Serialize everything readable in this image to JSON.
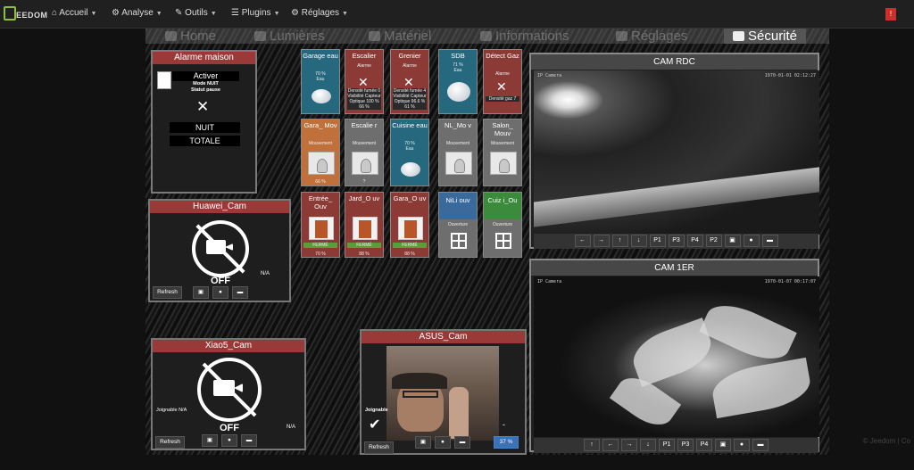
{
  "brand": {
    "name": "EEDOM"
  },
  "nav": {
    "items": [
      {
        "label": "Accueil",
        "icon": "home-icon"
      },
      {
        "label": "Analyse",
        "icon": "analyse-icon"
      },
      {
        "label": "Outils",
        "icon": "wrench-icon"
      },
      {
        "label": "Plugins",
        "icon": "plugins-icon"
      },
      {
        "label": "Réglages",
        "icon": "gears-icon"
      }
    ],
    "alert_count": "!"
  },
  "tabs": [
    "Home",
    "Lumières",
    "Matériel",
    "Informations",
    "Réglages",
    "Sécurité"
  ],
  "alarm": {
    "title": "Alarme maison",
    "activate": "Activer",
    "mode": "Mode NUIT",
    "status": "Statut pause",
    "night": "NUIT",
    "total": "TOTALE"
  },
  "tiles": {
    "garage": {
      "name": "Garage eau",
      "pct": "70 %",
      "label": "Eau"
    },
    "escalier": {
      "name": "Escalier",
      "small": "Alarme",
      "details": "Densité fumée 0 Visibilité Capteur Optique 100 %",
      "bat": "66 %"
    },
    "grenier": {
      "name": "Grenier",
      "small": "Alarme",
      "details": "Densité fumée 4 Visibilité Capteur Optique 96.6 %",
      "bat": "61 %"
    },
    "sdb": {
      "name": "SDB",
      "pct": "71 %",
      "label": "Eau"
    },
    "gaz": {
      "name": "Détect Gaz",
      "small": "Alarme",
      "details": "Densité gaz 7"
    },
    "garamov": {
      "name": "Gara_ Mov",
      "small": "Mouvement",
      "pct": "66 %"
    },
    "escalieri": {
      "name": "Escalie r",
      "small": "Mouvement",
      "pct": "?"
    },
    "cuisine": {
      "name": "Cuisine eau",
      "pct": "70 %",
      "label": "Eau"
    },
    "nlmo": {
      "name": "NL_Mo v",
      "small": "Mouvement"
    },
    "salon": {
      "name": "Salon_ Mouv",
      "small": "Mouvement"
    },
    "entree": {
      "name": "Entrée_ Ouv",
      "state": "FERMÉ",
      "pct": "70 %"
    },
    "jard": {
      "name": "Jard_O uv",
      "state": "FERMÉ",
      "pct": "88 %"
    },
    "garao": {
      "name": "Gara_O uv",
      "state": "FERMÉ",
      "pct": "88 %"
    },
    "nili": {
      "name": "NiLi ouv",
      "small": "Ouverture"
    },
    "cuiz": {
      "name": "Cuiz i_Ou",
      "small": "Ouverture"
    }
  },
  "huawei": {
    "title": "Huawei_Cam",
    "off": "OFF",
    "status": "N/A",
    "refresh": "Refresh"
  },
  "xiao": {
    "title": "Xiao5_Cam",
    "off": "OFF",
    "joign": "Joignable N/A",
    "status": "N/A",
    "refresh": "Refresh"
  },
  "asus": {
    "title": "ASUS_Cam",
    "joign": "Joignable",
    "check": "✔",
    "dash": "-",
    "refresh": "Refresh",
    "pct": "37 %"
  },
  "camrdc": {
    "title": "CAM RDC",
    "stamp_l": "IP Camera",
    "stamp_r": "1970-01-01 02:12:27",
    "buttons": [
      "←",
      "→",
      "↑",
      "↓",
      "P1",
      "P3",
      "P4",
      "P2"
    ]
  },
  "cam1er": {
    "title": "CAM 1ER",
    "stamp_l": "IP Camera",
    "stamp_r": "1970-01-07 00:17:07",
    "buttons": [
      "↑",
      "←",
      "→",
      "↓",
      "P1",
      "P3",
      "P4"
    ]
  },
  "footer": "© Jeedom | Co"
}
